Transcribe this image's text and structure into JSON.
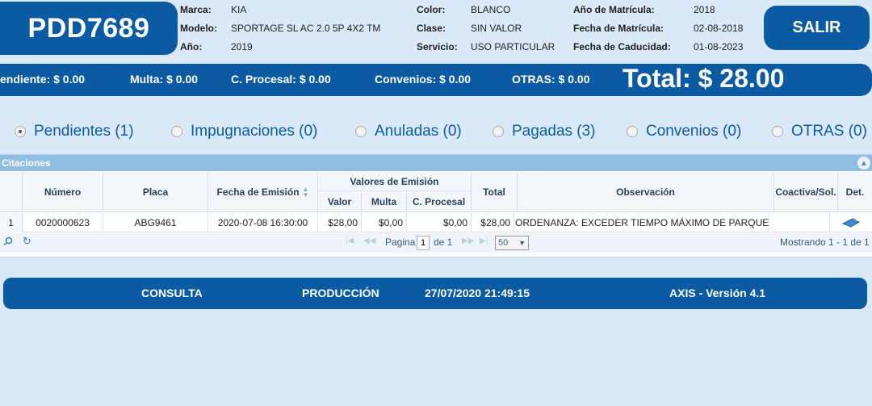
{
  "vehicle": {
    "plate": "PDD7689",
    "marca_label": "Marca:",
    "marca": "KIA",
    "modelo_label": "Modelo:",
    "modelo": "SPORTAGE SL AC 2.0 5P 4X2 TM",
    "anio_label": "Año:",
    "anio": "2019",
    "color_label": "Color:",
    "color": "BLANCO",
    "clase_label": "Clase:",
    "clase": "SIN VALOR",
    "servicio_label": "Servicio:",
    "servicio": "USO PARTICULAR",
    "anio_matricula_label": "Año de Matrícula:",
    "anio_matricula": "2018",
    "fecha_matricula_label": "Fecha de Matrícula:",
    "fecha_matricula": "02-08-2018",
    "fecha_caducidad_label": "Fecha de Caducidad:",
    "fecha_caducidad": "01-08-2023"
  },
  "salir_label": "SALIR",
  "summary": {
    "pendiente": "endiente: $ 0.00",
    "multa": "Multa: $ 0.00",
    "c_procesal": "C. Procesal: $ 0.00",
    "convenios": "Convenios: $ 0.00",
    "otras": "OTRAS: $ 0.00",
    "total": "Total: $ 28.00"
  },
  "tabs": [
    {
      "label": "Pendientes (1)",
      "selected": true
    },
    {
      "label": "Impugnaciones (0)",
      "selected": false
    },
    {
      "label": "Anuladas (0)",
      "selected": false
    },
    {
      "label": "Pagadas (3)",
      "selected": false
    },
    {
      "label": "Convenios (0)",
      "selected": false
    },
    {
      "label": "OTRAS (0)",
      "selected": false
    }
  ],
  "grid": {
    "title": "Citaciones",
    "headers": {
      "numero": "Número",
      "placa": "Placa",
      "fecha_emision": "Fecha de Emisión",
      "valores_emision": "Valores de Emisión",
      "valor": "Valor",
      "multa": "Multa",
      "c_procesal": "C. Procesal",
      "total": "Total",
      "observacion": "Observación",
      "coactiva": "Coactiva/Sol.",
      "det": "Det."
    },
    "rows": [
      {
        "index": "1",
        "numero": "0020000623",
        "placa": "ABG9461",
        "fecha": "2020-07-08 16:30:00",
        "valor": "$28,00",
        "multa": "$0,00",
        "c_procesal": "$0,00",
        "total": "$28,00",
        "observacion": "ORDENANZA:  EXCEDER TIEMPO MÁXIMO DE PARQUEO/",
        "coactiva": ""
      }
    ],
    "pager": {
      "pagina_label": "Pagina",
      "page": "1",
      "de_label": "de 1",
      "page_size": "50",
      "mostrando": "Mostrando 1 - 1 de 1"
    }
  },
  "footer": {
    "consulta": "CONSULTA",
    "produccion": "PRODUCCIÓN",
    "datetime": "27/07/2020 21:49:15",
    "version": "AXIS - Versión 4.1"
  }
}
